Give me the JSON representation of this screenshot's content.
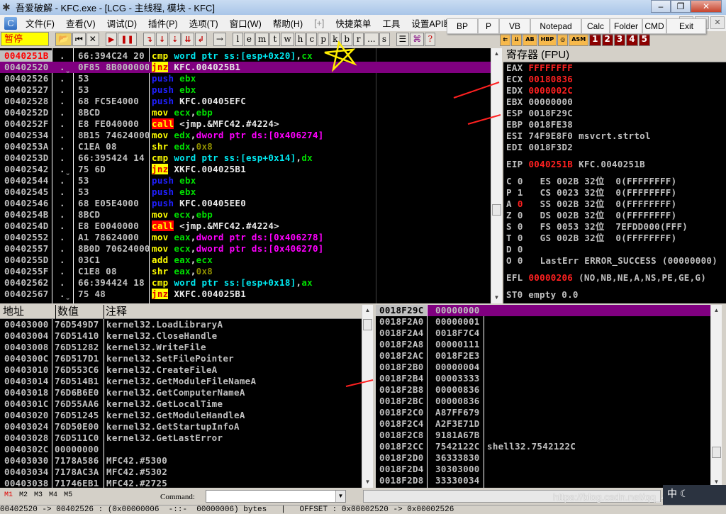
{
  "window": {
    "title": "吾爱破解 - KFC.exe - [LCG -  主线程, 模块 - KFC]",
    "controls": [
      "–",
      "❐",
      "✕"
    ]
  },
  "menu": {
    "items": [
      "文件(F)",
      "查看(V)",
      "调试(D)",
      "插件(P)",
      "选项(T)",
      "窗口(W)",
      "帮助(H)",
      "[+]",
      "快捷菜单",
      "工具",
      "设置API断点>"
    ],
    "mdi": [
      "–",
      "❐",
      "✕"
    ]
  },
  "popup_buttons": [
    "BP",
    "P",
    "VB",
    "Notepad",
    "Calc",
    "Folder",
    "CMD",
    "Exit"
  ],
  "toolbar": {
    "status": "暂停",
    "letters": [
      "l",
      "e",
      "m",
      "t",
      "w",
      "h",
      "c",
      "p",
      "k",
      "b",
      "r",
      "...",
      "s"
    ],
    "help": "?",
    "orange": [
      "⇇",
      "⇊",
      "AB",
      "HBP",
      "◎",
      "ASM"
    ],
    "numbers": [
      "1",
      "2",
      "3",
      "4",
      "5"
    ]
  },
  "disasm": {
    "rows": [
      {
        "addr": "0040251B",
        "mark": ".",
        "hex": "66:394C24 20",
        "mn": "cmp",
        "mc": "c-yel",
        "ops": [
          [
            "word ptr ss:[esp+0x20]",
            "c-cyn"
          ],
          [
            ",",
            "c-wht"
          ],
          [
            "cx",
            "c-grn"
          ]
        ],
        "current": true
      },
      {
        "addr": "00402520",
        "mark": ".ˬ",
        "hex": "0F85 8B000000",
        "mn": "jnz",
        "mc": "m-jnz",
        "ops": [
          [
            "KFC.004025B1",
            "c-wht"
          ]
        ],
        "selected": true
      },
      {
        "addr": "00402526",
        "mark": ".",
        "hex": "53",
        "mn": "push",
        "mc": "c-blu",
        "ops": [
          [
            "ebx",
            "c-grn"
          ]
        ]
      },
      {
        "addr": "00402527",
        "mark": ".",
        "hex": "53",
        "mn": "push",
        "mc": "c-blu",
        "ops": [
          [
            "ebx",
            "c-grn"
          ]
        ]
      },
      {
        "addr": "00402528",
        "mark": ".",
        "hex": "68 FC5E4000",
        "mn": "push",
        "mc": "c-blu",
        "ops": [
          [
            "KFC.00405EFC",
            "c-wht"
          ]
        ]
      },
      {
        "addr": "0040252D",
        "mark": ".",
        "hex": "8BCD",
        "mn": "mov",
        "mc": "c-yel",
        "ops": [
          [
            "ecx",
            "c-grn"
          ],
          [
            ",",
            "c-wht"
          ],
          [
            "ebp",
            "c-grn"
          ]
        ]
      },
      {
        "addr": "0040252F",
        "mark": ".",
        "hex": "E8 FE040000",
        "mn": "call",
        "mc": "m-call",
        "ops": [
          [
            "<jmp.&MFC42.#4224>",
            "c-wht"
          ]
        ]
      },
      {
        "addr": "00402534",
        "mark": ".",
        "hex": "8B15 74624000",
        "mn": "mov",
        "mc": "c-yel",
        "ops": [
          [
            "edx",
            "c-grn"
          ],
          [
            ",",
            "c-wht"
          ],
          [
            "dword ptr ds:[0x406274]",
            "c-mag"
          ]
        ]
      },
      {
        "addr": "0040253A",
        "mark": ".",
        "hex": "C1EA 08",
        "mn": "shr",
        "mc": "c-yel",
        "ops": [
          [
            "edx",
            "c-grn"
          ],
          [
            ",",
            "c-wht"
          ],
          [
            "0x8",
            "c-olv"
          ]
        ]
      },
      {
        "addr": "0040253D",
        "mark": ".",
        "hex": "66:395424 14",
        "mn": "cmp",
        "mc": "c-yel",
        "ops": [
          [
            "word ptr ss:[esp+0x14]",
            "c-cyn"
          ],
          [
            ",",
            "c-wht"
          ],
          [
            "dx",
            "c-grn"
          ]
        ]
      },
      {
        "addr": "00402542",
        "mark": ".ˬ",
        "hex": "75 6D",
        "mn": "jnz",
        "mc": "m-jnz",
        "ops": [
          [
            "XKFC.004025B1",
            "c-wht"
          ]
        ]
      },
      {
        "addr": "00402544",
        "mark": ".",
        "hex": "53",
        "mn": "push",
        "mc": "c-blu",
        "ops": [
          [
            "ebx",
            "c-grn"
          ]
        ]
      },
      {
        "addr": "00402545",
        "mark": ".",
        "hex": "53",
        "mn": "push",
        "mc": "c-blu",
        "ops": [
          [
            "ebx",
            "c-grn"
          ]
        ]
      },
      {
        "addr": "00402546",
        "mark": ".",
        "hex": "68 E05E4000",
        "mn": "push",
        "mc": "c-blu",
        "ops": [
          [
            "KFC.00405EE0",
            "c-wht"
          ]
        ]
      },
      {
        "addr": "0040254B",
        "mark": ".",
        "hex": "8BCD",
        "mn": "mov",
        "mc": "c-yel",
        "ops": [
          [
            "ecx",
            "c-grn"
          ],
          [
            ",",
            "c-wht"
          ],
          [
            "ebp",
            "c-grn"
          ]
        ]
      },
      {
        "addr": "0040254D",
        "mark": ".",
        "hex": "E8 E0040000",
        "mn": "call",
        "mc": "m-call",
        "ops": [
          [
            "<jmp.&MFC42.#4224>",
            "c-wht"
          ]
        ]
      },
      {
        "addr": "00402552",
        "mark": ".",
        "hex": "A1 78624000",
        "mn": "mov",
        "mc": "c-yel",
        "ops": [
          [
            "eax",
            "c-grn"
          ],
          [
            ",",
            "c-wht"
          ],
          [
            "dword ptr ds:[0x406278]",
            "c-mag"
          ]
        ]
      },
      {
        "addr": "00402557",
        "mark": ".",
        "hex": "8B0D 70624000",
        "mn": "mov",
        "mc": "c-yel",
        "ops": [
          [
            "ecx",
            "c-grn"
          ],
          [
            ",",
            "c-wht"
          ],
          [
            "dword ptr ds:[0x406270]",
            "c-mag"
          ]
        ]
      },
      {
        "addr": "0040255D",
        "mark": ".",
        "hex": "03C1",
        "mn": "add",
        "mc": "c-yel",
        "ops": [
          [
            "eax",
            "c-grn"
          ],
          [
            ",",
            "c-wht"
          ],
          [
            "ecx",
            "c-grn"
          ]
        ]
      },
      {
        "addr": "0040255F",
        "mark": ".",
        "hex": "C1E8 08",
        "mn": "shr",
        "mc": "c-yel",
        "ops": [
          [
            "eax",
            "c-grn"
          ],
          [
            ",",
            "c-wht"
          ],
          [
            "0x8",
            "c-olv"
          ]
        ]
      },
      {
        "addr": "00402562",
        "mark": ".",
        "hex": "66:394424 18",
        "mn": "cmp",
        "mc": "c-yel",
        "ops": [
          [
            "word ptr ss:[esp+0x18]",
            "c-cyn"
          ],
          [
            ",",
            "c-wht"
          ],
          [
            "ax",
            "c-grn"
          ]
        ]
      },
      {
        "addr": "00402567",
        "mark": ".ˬ",
        "hex": "75 48",
        "mn": "jnz",
        "mc": "m-jnz",
        "ops": [
          [
            "XKFC.004025B1",
            "c-wht"
          ]
        ]
      }
    ]
  },
  "registers": {
    "title": "寄存器 (FPU)",
    "lines": [
      {
        "name": "EAX",
        "value": "FFFFFFFF",
        "changed": true,
        "comment": ""
      },
      {
        "name": "ECX",
        "value": "00180836",
        "changed": true,
        "comment": ""
      },
      {
        "name": "EDX",
        "value": "0000002C",
        "changed": true,
        "comment": ""
      },
      {
        "name": "EBX",
        "value": "00000000",
        "changed": false,
        "comment": ""
      },
      {
        "name": "ESP",
        "value": "0018F29C",
        "changed": false,
        "comment": ""
      },
      {
        "name": "EBP",
        "value": "0018FE38",
        "changed": false,
        "comment": ""
      },
      {
        "name": "ESI",
        "value": "74F9E8F0",
        "changed": false,
        "comment": "msvcrt.strtol"
      },
      {
        "name": "EDI",
        "value": "0018F3D2",
        "changed": false,
        "comment": ""
      }
    ],
    "eip": {
      "name": "EIP",
      "value": "0040251B",
      "comment": "KFC.0040251B"
    },
    "flags": [
      {
        "f": "C",
        "v": "0",
        "seg": "ES 002B 32位  0(FFFFFFFF)"
      },
      {
        "f": "P",
        "v": "1",
        "seg": "CS 0023 32位  0(FFFFFFFF)"
      },
      {
        "f": "A",
        "v": "0",
        "seg": "SS 002B 32位  0(FFFFFFFF)",
        "changed": true
      },
      {
        "f": "Z",
        "v": "0",
        "seg": "DS 002B 32位  0(FFFFFFFF)"
      },
      {
        "f": "S",
        "v": "0",
        "seg": "FS 0053 32位  7EFDD000(FFF)"
      },
      {
        "f": "T",
        "v": "0",
        "seg": "GS 002B 32位  0(FFFFFFFF)"
      },
      {
        "f": "D",
        "v": "0",
        "seg": ""
      },
      {
        "f": "O",
        "v": "0",
        "seg": "LastErr ERROR_SUCCESS (00000000)"
      }
    ],
    "efl": {
      "name": "EFL",
      "value": "00000206",
      "comment": "(NO,NB,NE,A,NS,PE,GE,G)"
    },
    "st0": "ST0 empty 0.0"
  },
  "dump": {
    "headers": [
      "地址",
      "数值",
      "注释"
    ],
    "rows": [
      [
        "00403000",
        "76D549D7",
        "kernel32.LoadLibraryA"
      ],
      [
        "00403004",
        "76D51410",
        "kernel32.CloseHandle"
      ],
      [
        "00403008",
        "76D51282",
        "kernel32.WriteFile"
      ],
      [
        "0040300C",
        "76D517D1",
        "kernel32.SetFilePointer"
      ],
      [
        "00403010",
        "76D553C6",
        "kernel32.CreateFileA"
      ],
      [
        "00403014",
        "76D514B1",
        "kernel32.GetModuleFileNameA"
      ],
      [
        "00403018",
        "76D6B6E0",
        "kernel32.GetComputerNameA"
      ],
      [
        "0040301C",
        "76D55AA6",
        "kernel32.GetLocalTime"
      ],
      [
        "00403020",
        "76D51245",
        "kernel32.GetModuleHandleA"
      ],
      [
        "00403024",
        "76D50E00",
        "kernel32.GetStartupInfoA"
      ],
      [
        "00403028",
        "76D511C0",
        "kernel32.GetLastError"
      ],
      [
        "0040302C",
        "00000000",
        ""
      ],
      [
        "00403030",
        "7178A586",
        "MFC42.#5300"
      ],
      [
        "00403034",
        "7178AC3A",
        "MFC42.#5302"
      ],
      [
        "00403038",
        "71746EB1",
        "MFC42.#2725"
      ]
    ]
  },
  "stack": {
    "rows": [
      [
        "0018F29C",
        "00000000",
        ""
      ],
      [
        "0018F2A0",
        "00000001",
        ""
      ],
      [
        "0018F2A4",
        "0018F7C4",
        ""
      ],
      [
        "0018F2A8",
        "00000111",
        ""
      ],
      [
        "0018F2AC",
        "0018F2E3",
        ""
      ],
      [
        "0018F2B0",
        "00000004",
        ""
      ],
      [
        "0018F2B4",
        "00003333",
        ""
      ],
      [
        "0018F2B8",
        "00000836",
        ""
      ],
      [
        "0018F2BC",
        "00000836",
        ""
      ],
      [
        "0018F2C0",
        "A87FF679",
        ""
      ],
      [
        "0018F2C4",
        "A2F3E71D",
        ""
      ],
      [
        "0018F2C8",
        "9181A67B",
        ""
      ],
      [
        "0018F2CC",
        "7542122C",
        "shell32.7542122C"
      ],
      [
        "0018F2D0",
        "36333830",
        ""
      ],
      [
        "0018F2D4",
        "30303000",
        ""
      ],
      [
        "0018F2D8",
        "33330034",
        ""
      ]
    ]
  },
  "bottom": {
    "memtabs": [
      "M1",
      "M2",
      "M3",
      "M4",
      "M5"
    ],
    "command_label": "Command:",
    "command_value": "",
    "watermark": "https://blog.csdn.net/qq_45740212"
  },
  "status": "00402520 -> 00402526 : (0x00000006  -::-  00000006) bytes   |   OFFSET : 0x00002520 -> 0x00002526",
  "colors": {
    "selection": "#800080",
    "changed": "#ff2020",
    "pause_bg": "#ffff00"
  }
}
